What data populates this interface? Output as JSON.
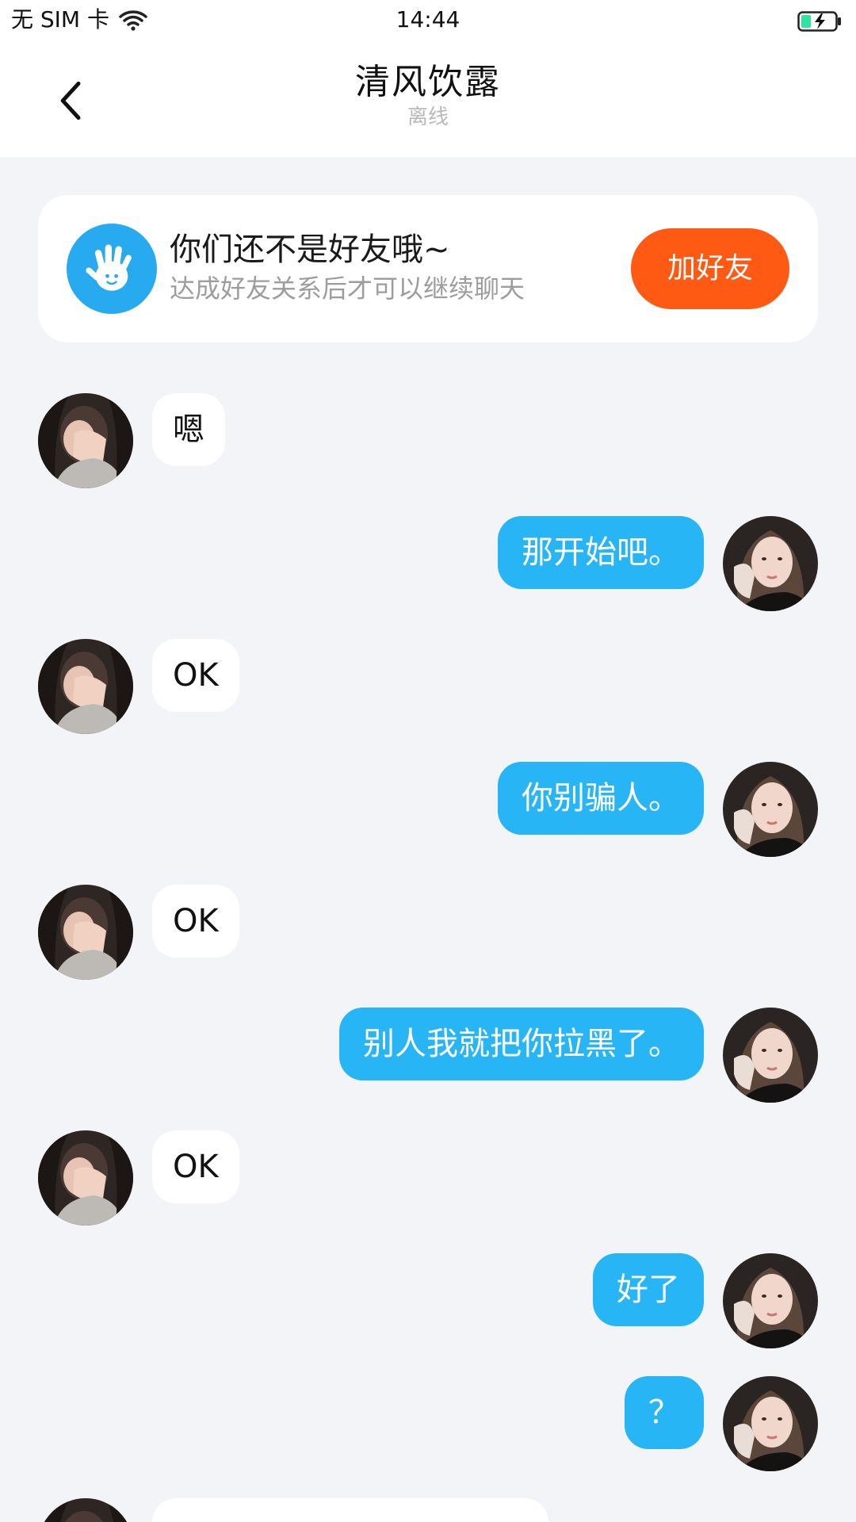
{
  "status_bar": {
    "carrier": "无 SIM 卡",
    "time": "14:44"
  },
  "header": {
    "title": "清风饮露",
    "status": "离线"
  },
  "friend_banner": {
    "title": "你们还不是好友哦~",
    "description": "达成好友关系后才可以继续聊天",
    "button_label": "加好友"
  },
  "messages": [
    {
      "side": "left",
      "text": "嗯"
    },
    {
      "side": "right",
      "text": "那开始吧。"
    },
    {
      "side": "left",
      "text": "OK"
    },
    {
      "side": "right",
      "text": "你别骗人。"
    },
    {
      "side": "left",
      "text": "OK"
    },
    {
      "side": "right",
      "text": "别人我就把你拉黑了。"
    },
    {
      "side": "left",
      "text": "OK"
    },
    {
      "side": "right",
      "text": "好了"
    },
    {
      "side": "right",
      "text": "？"
    },
    {
      "side": "left",
      "text": ""
    }
  ],
  "colors": {
    "accent_blue": "#27b5f6",
    "add_button": "#ff5a14",
    "background": "#f3f4f7",
    "battery_charge": "#2ee59d"
  },
  "icons": {
    "back": "chevron-left-icon",
    "wifi": "wifi-icon",
    "battery": "battery-charging-icon",
    "banner": "hand-wave-icon"
  }
}
